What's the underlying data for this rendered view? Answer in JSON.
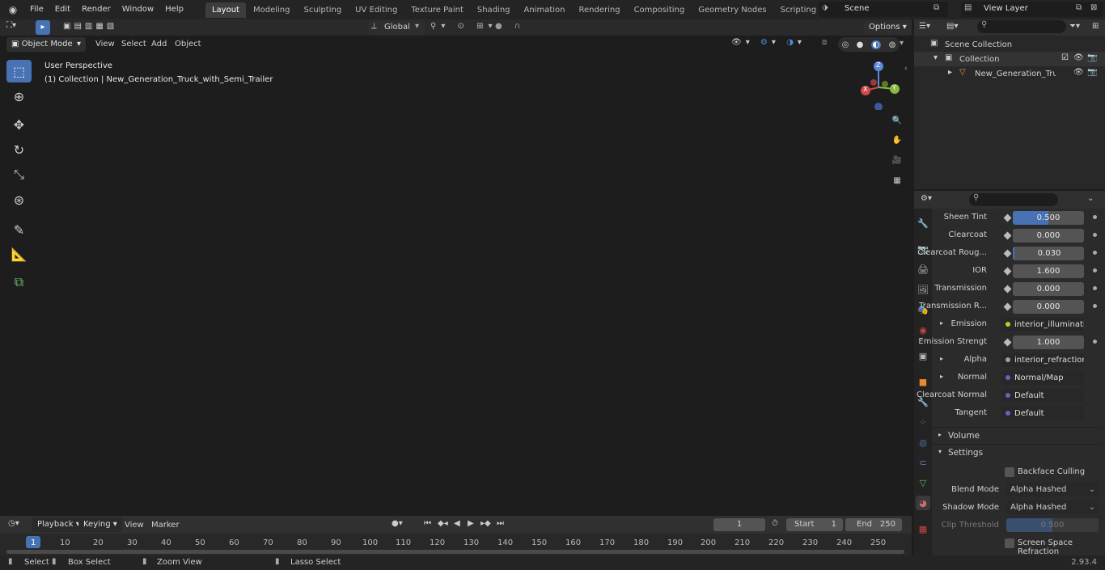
{
  "menu": [
    "File",
    "Edit",
    "Render",
    "Window",
    "Help"
  ],
  "workspaces": [
    "Layout",
    "Modeling",
    "Sculpting",
    "UV Editing",
    "Texture Paint",
    "Shading",
    "Animation",
    "Rendering",
    "Compositing",
    "Geometry Nodes",
    "Scripting"
  ],
  "scene_name": "Scene",
  "view_layer": "View Layer",
  "viewport": {
    "mode": "Object Mode",
    "menus": [
      "View",
      "Select",
      "Add",
      "Object"
    ],
    "transform_orientation": "Global",
    "options_label": "Options",
    "overlay_title": "User Perspective",
    "overlay_subtitle": "(1) Collection | New_Generation_Truck_with_Semi_Trailer",
    "gizmo_axes": [
      "Z",
      "Y",
      "X"
    ]
  },
  "outliner": {
    "scene_collection": "Scene Collection",
    "collection": "Collection",
    "object": "New_Generation_Truck_v"
  },
  "properties": {
    "rows": [
      {
        "label": "Sheen Tint",
        "value": "0.500",
        "fill": 0.5
      },
      {
        "label": "Clearcoat",
        "value": "0.000"
      },
      {
        "label": "Clearcoat Roug...",
        "value": "0.030"
      },
      {
        "label": "IOR",
        "value": "1.600"
      },
      {
        "label": "Transmission",
        "value": "0.000"
      },
      {
        "label": "Transmission R...",
        "value": "0.000"
      }
    ],
    "emission": {
      "label": "Emission",
      "link": "interior_illumination..."
    },
    "emission_strength": {
      "label": "Emission Strengt",
      "value": "1.000"
    },
    "alpha": {
      "label": "Alpha",
      "link": "interior_refraction_in..."
    },
    "normal": {
      "label": "Normal",
      "link": "Normal/Map"
    },
    "clearcoat_normal": {
      "label": "Clearcoat Normal",
      "link": "Default"
    },
    "tangent": {
      "label": "Tangent",
      "link": "Default"
    },
    "volume_panel": "Volume",
    "settings_panel": "Settings",
    "backface_culling": "Backface Culling",
    "blend_mode": {
      "label": "Blend Mode",
      "value": "Alpha Hashed"
    },
    "shadow_mode": {
      "label": "Shadow Mode",
      "value": "Alpha Hashed"
    },
    "clip_threshold": {
      "label": "Clip Threshold",
      "value": "0.500"
    },
    "screen_space_refraction": "Screen Space Refraction"
  },
  "timeline": {
    "menus": [
      "Playback",
      "Keying",
      "View",
      "Marker"
    ],
    "current_frame": "1",
    "start_label": "Start",
    "start": "1",
    "end_label": "End",
    "end": "250",
    "ticks": [
      "1",
      "10",
      "20",
      "30",
      "40",
      "50",
      "60",
      "70",
      "80",
      "90",
      "100",
      "110",
      "120",
      "130",
      "140",
      "150",
      "160",
      "170",
      "180",
      "190",
      "200",
      "210",
      "220",
      "230",
      "240",
      "250"
    ]
  },
  "statusbar": {
    "select": "Select",
    "box_select": "Box Select",
    "zoom_view": "Zoom View",
    "lasso_select": "Lasso Select",
    "version": "2.93.4"
  },
  "colors": {
    "accent": "#4772b3",
    "truck_red": "#c8202a",
    "trailer": "#c9c9c6"
  }
}
